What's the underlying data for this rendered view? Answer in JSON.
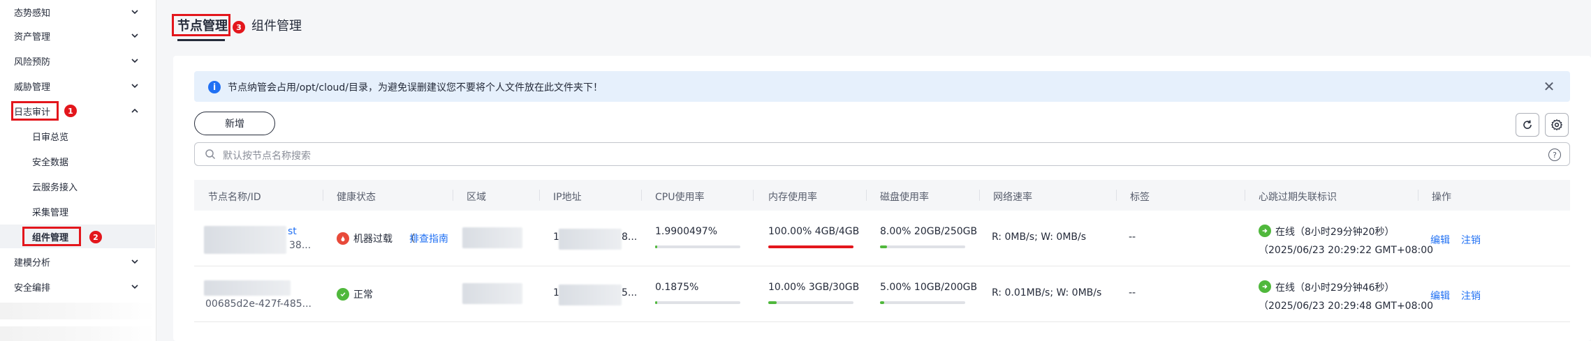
{
  "sidebar": {
    "items": [
      {
        "label": "态势感知"
      },
      {
        "label": "资产管理"
      },
      {
        "label": "风险预防"
      },
      {
        "label": "威胁管理"
      },
      {
        "label": "日志审计"
      },
      {
        "label": "建模分析"
      },
      {
        "label": "安全编排"
      }
    ],
    "subitems": [
      {
        "label": "日审总览"
      },
      {
        "label": "安全数据"
      },
      {
        "label": "云服务接入"
      },
      {
        "label": "采集管理"
      },
      {
        "label": "组件管理"
      }
    ],
    "badges": [
      "1",
      "2"
    ]
  },
  "tabs": [
    {
      "label": "节点管理"
    },
    {
      "label": "组件管理"
    }
  ],
  "tab_badge": "3",
  "notice": {
    "text": "节点纳管会占用/opt/cloud/目录，为避免误删建议您不要将个人文件放在此文件夹下！",
    "icon": "info-icon",
    "close": "✕"
  },
  "toolbar": {
    "add_label": "新增",
    "refresh_icon": "refresh-icon",
    "settings_icon": "gear-icon"
  },
  "search": {
    "placeholder": "默认按节点名称搜索",
    "help": "?"
  },
  "table": {
    "headers": [
      "节点名称/ID",
      "健康状态",
      "区域",
      "IP地址",
      "CPU使用率",
      "内存使用率",
      "磁盘使用率",
      "网络速率",
      "标签",
      "心跳过期失联标识",
      "操作"
    ],
    "rows": [
      {
        "name_tail": "st",
        "id_tail": "38...",
        "health": "机器过载",
        "health_link": "排查指南",
        "health_paren": "（",
        "ip_head": "1",
        "ip_tail": "8...",
        "cpu": "1.9900497%",
        "cpu_pct": 1.99,
        "mem": "100.00%   4GB/4GB",
        "mem_pct": 100,
        "disk": "8.00%   20GB/250GB",
        "disk_pct": 8,
        "net": "R: 0MB/s; W: 0MB/s",
        "tag": "--",
        "heartbeat": "在线（8小时29分钟20秒）",
        "heartbeat_time": "（2025/06/23 20:29:22 GMT+08:00",
        "actions": [
          "编辑",
          "注销"
        ]
      },
      {
        "id_text": "00685d2e-427f-485...",
        "health": "正常",
        "ip_head": "1",
        "ip_tail": "5...",
        "cpu": "0.1875%",
        "cpu_pct": 0.19,
        "mem": "10.00%   3GB/30GB",
        "mem_pct": 10,
        "disk": "5.00%   10GB/200GB",
        "disk_pct": 5,
        "net": "R: 0.01MB/s; W: 0MB/s",
        "tag": "--",
        "heartbeat": "在线（8小时29分钟46秒）",
        "heartbeat_time": "（2025/06/23 20:29:48 GMT+08:00",
        "actions": [
          "编辑",
          "注销"
        ]
      }
    ]
  },
  "colors": {
    "accent": "#2070f3",
    "danger": "#e3161c",
    "success": "#50b83c",
    "overload": "#e84a3a"
  }
}
